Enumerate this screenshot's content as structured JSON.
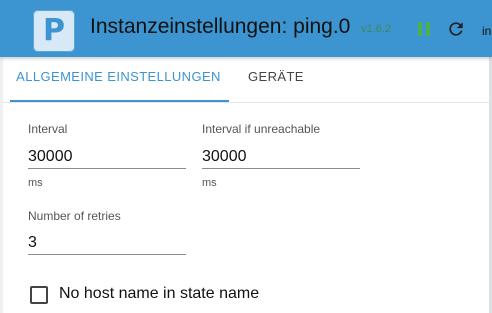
{
  "header": {
    "logo_letter": "P",
    "title": "Instanzeinstellungen: ping.0",
    "version": "v1.6.2",
    "pause_icon": "pause-icon",
    "reload_icon": "reload-icon",
    "truncated_text": "in"
  },
  "tabs": [
    {
      "label": "ALLGEMEINE EINSTELLUNGEN",
      "active": true
    },
    {
      "label": "GERÄTE",
      "active": false
    }
  ],
  "form": {
    "interval": {
      "label": "Interval",
      "value": "30000",
      "help": "ms"
    },
    "interval_unreachable": {
      "label": "Interval if unreachable",
      "value": "30000",
      "help": "ms"
    },
    "retries": {
      "label": "Number of retries",
      "value": "3"
    },
    "no_host_name": {
      "label": "No host name in state name",
      "checked": false
    }
  },
  "colors": {
    "accent": "#3c94d0",
    "version_green": "#3c8c55",
    "pause_green": "#4caf50"
  }
}
